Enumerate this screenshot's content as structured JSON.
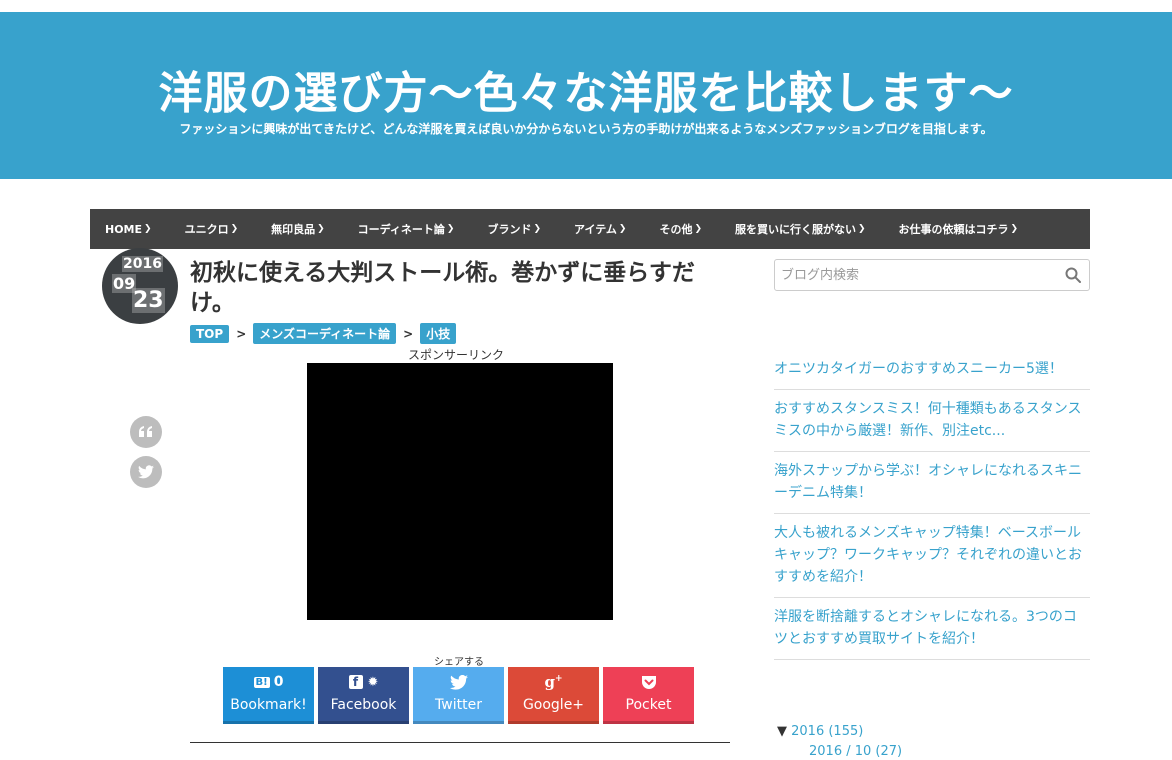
{
  "header": {
    "title": "洋服の選び方～色々な洋服を比較します～",
    "description": "ファッションに興味が出てきたけど、どんな洋服を買えば良いか分からないという方の手助けが出来るようなメンズファッションブログを目指します。"
  },
  "nav": {
    "items": [
      {
        "label": "HOME"
      },
      {
        "label": "ユニクロ"
      },
      {
        "label": "無印良品"
      },
      {
        "label": "コーディネート論"
      },
      {
        "label": "ブランド"
      },
      {
        "label": "アイテム"
      },
      {
        "label": "その他"
      },
      {
        "label": "服を買いに行く服がない"
      },
      {
        "label": "お仕事の依頼はコチラ"
      }
    ]
  },
  "post": {
    "date": {
      "year": "2016",
      "month": "09",
      "day": "23"
    },
    "title": "初秋に使える大判ストール術。巻かずに垂らすだけ。",
    "breadcrumb": [
      "TOP",
      "メンズコーディネート論",
      "小技"
    ],
    "breadcrumb_sep": ">",
    "sponsor_label": "スポンサーリンク"
  },
  "share": {
    "label": "シェアする",
    "buttons": [
      {
        "label": "Bookmark!",
        "count": "0",
        "color": "#1d8fd6"
      },
      {
        "label": "Facebook",
        "color": "#33508f"
      },
      {
        "label": "Twitter",
        "color": "#55acee"
      },
      {
        "label": "Google+",
        "color": "#dc4a38"
      },
      {
        "label": "Pocket",
        "color": "#ee4056"
      }
    ]
  },
  "sidebar": {
    "search_placeholder": "ブログ内検索",
    "recent_posts": [
      "オニツカタイガーのおすすめスニーカー5選！",
      "おすすめスタンスミス！何十種類もあるスタンスミスの中から厳選！新作、別注etc...",
      "海外スナップから学ぶ！オシャレになれるスキニーデニム特集！",
      "大人も被れるメンズキャップ特集！ベースボールキャップ？ワークキャップ？それぞれの違いとおすすめを紹介！",
      "洋服を断捨離するとオシャレになれる。3つのコツとおすすめ買取サイトを紹介！"
    ],
    "archive": {
      "year_toggle": "▼",
      "year_label": "2016 (155)",
      "month_label": "2016 / 10 (27)"
    }
  },
  "colors": {
    "accent": "#38a2cc",
    "nav_bg": "#434343"
  }
}
